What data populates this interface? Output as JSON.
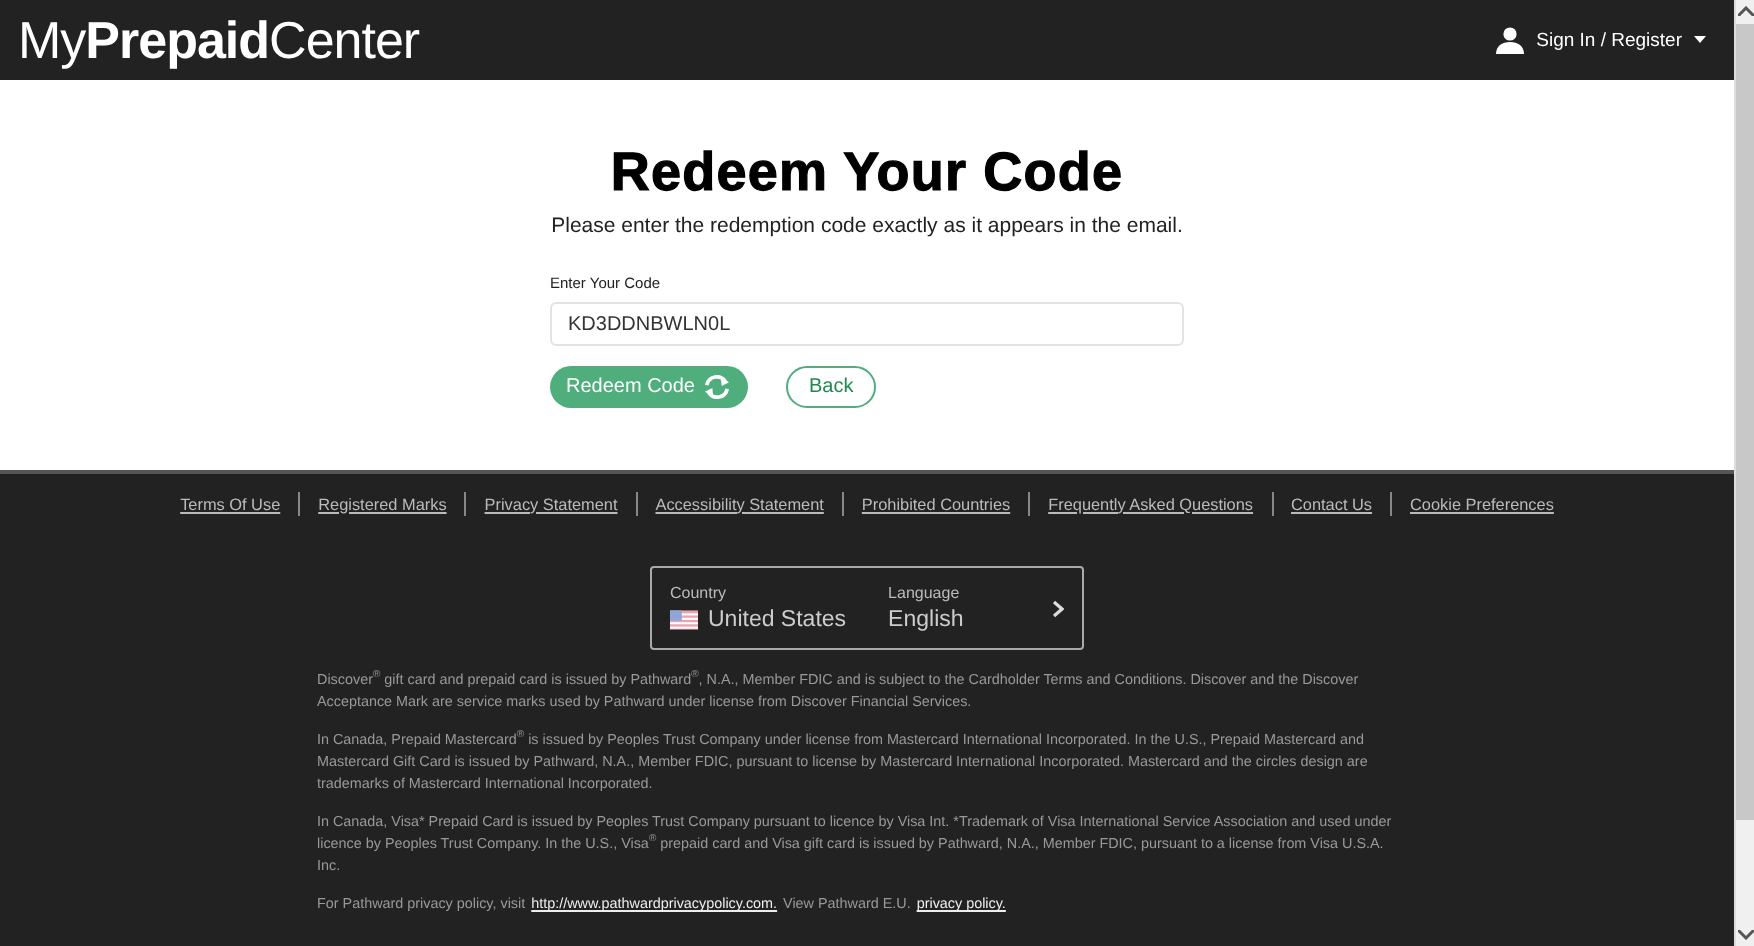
{
  "header": {
    "logo": "My**Prepaid**Center",
    "account_menu": "Sign In / Register"
  },
  "main": {
    "title": "Redeem Your Code",
    "instructions": "Please enter the redemption code exactly as it appears in the email.",
    "field": {
      "label": "Enter Your Code",
      "value": "KD3DDNBWLN0L"
    },
    "buttons": [
      {
        "label": "Redeem Code",
        "kind": "primary"
      },
      {
        "label": "Back",
        "kind": "outline"
      }
    ]
  },
  "footer": {
    "links": [
      "Terms Of Use",
      "Registered Marks",
      "Privacy Statement",
      "Accessibility Statement",
      "Prohibited Countries",
      "Frequently Asked Questions",
      "Contact Us",
      "Cookie Preferences"
    ],
    "locale": {
      "country_label": "Country",
      "country": "United States",
      "language_label": "Language",
      "language": "English"
    },
    "legal": [
      "Discover$^{®}$ gift card and prepaid card is issued by Pathward$^{®}$, N.A., Member FDIC and is subject to the Cardholder Terms and Conditions. Discover and the Discover Acceptance Mark are service marks used by Pathward under license from Discover Financial Services.",
      "In Canada, Prepaid Mastercard$^{®}$ is issued by Peoples Trust Company under license from Mastercard International Incorporated. In the U.S., Prepaid Mastercard and Mastercard Gift Card is issued by Pathward, N.A., Member FDIC, pursuant to license by Mastercard International Incorporated. Mastercard and the circles design are trademarks of Mastercard International Incorporated.",
      "In Canada, Visa* Prepaid Card is issued by Peoples Trust Company pursuant to licence by Visa Int. *Trademark of Visa International Service Association and used under licence by Peoples Trust Company. In the U.S., Visa$^{®}$ prepaid card and Visa gift card is issued by Pathward, N.A., Member FDIC, pursuant to a license from Visa U.S.A. Inc."
    ],
    "privacy": {
      "before": "For Pathward privacy policy, visit",
      "link": "http://www.pathwardprivacypolicy.com.",
      "middle": "View Pathward E.U.",
      "link_2": "privacy policy."
    }
  }
}
